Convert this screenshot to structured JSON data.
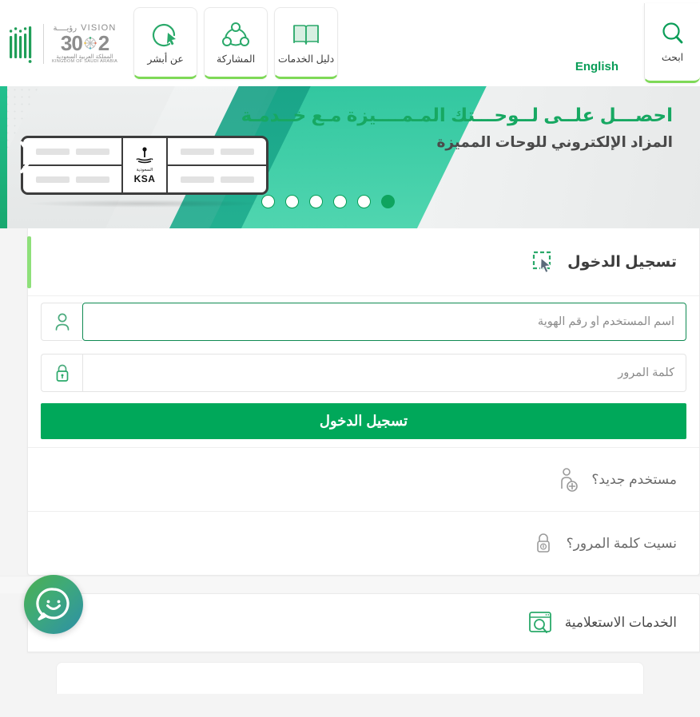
{
  "header": {
    "search_button": {
      "label": "ابحث",
      "icon": "search-icon"
    },
    "language_toggle": "English",
    "nav_items": [
      {
        "label": "دليل الخدمات",
        "icon": "book-icon"
      },
      {
        "label": "المشاركة",
        "icon": "share-network-icon"
      },
      {
        "label": "عن أبشر",
        "icon": "about-cursor-icon"
      }
    ],
    "vision_logo": {
      "word_en": "VISION",
      "word_ar": "رؤيــــة",
      "year_left": "2",
      "year_right": "30",
      "kingdom_ar": "المملكة العربية السعودية",
      "kingdom_en": "KINGDOM OF SAUDI ARABIA"
    },
    "brand_logo": "absher-logo"
  },
  "banner": {
    "headline": "احصـــل علــى لــوحـــتك المـمــــيزة مـع خــدمـة",
    "subline": "المزاد الإلكتروني للوحات المميزة",
    "plate": {
      "country_ar": "السعودية",
      "country_en": "KSA"
    },
    "dots_total": 6,
    "active_dot": 1,
    "next_arrow": "chevron-right-icon"
  },
  "login": {
    "title": "تسجيل الدخول",
    "title_icon": "select-cursor-icon",
    "username": {
      "placeholder": "اسم المستخدم أو رقم الهوية",
      "value": "",
      "icon": "user-icon",
      "focused": true
    },
    "password": {
      "placeholder": "كلمة المرور",
      "value": "",
      "icon": "lock-icon"
    },
    "submit_label": "تسجيل الدخول",
    "links": [
      {
        "label": "مستخدم جديد؟",
        "icon": "add-user-icon"
      },
      {
        "label": "نسيت كلمة المرور؟",
        "icon": "lock-question-icon"
      }
    ]
  },
  "services": {
    "title": "الخدمات الاستعلامية",
    "icon": "window-search-icon"
  },
  "chat": {
    "icon": "chat-smiley-icon"
  },
  "colors": {
    "brand_green": "#00a85a",
    "accent_green": "#8ee07a",
    "headline_green": "#17a862",
    "teal": "#25c39a",
    "text_dark": "#3c3c3c",
    "muted": "#6b6b6b",
    "page_bg": "#f4f4f4"
  }
}
